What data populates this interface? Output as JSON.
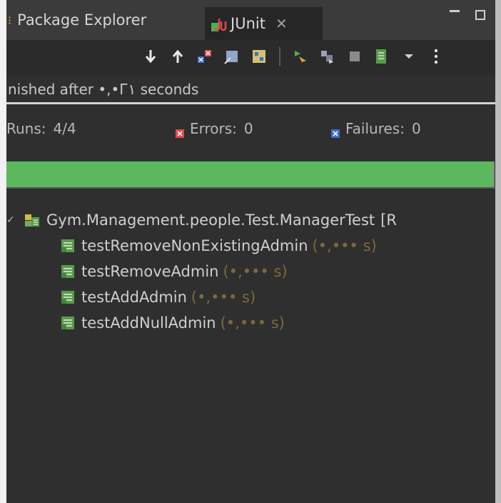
{
  "tabs": {
    "package_explorer": "Package Explorer",
    "junit": "JUnit"
  },
  "status": {
    "text": "nished after •,•Г١ seconds"
  },
  "counters": {
    "runs_label": "Runs:",
    "runs_value": "4/4",
    "errors_label": "Errors:",
    "errors_value": "0",
    "failures_label": "Failures:",
    "failures_value": "0"
  },
  "progress": {
    "fraction": 1.0,
    "color": "#5cb85c"
  },
  "tree": {
    "suite": {
      "name": "Gym.Management.people.Test.ManagerTest",
      "suffix": "[R"
    },
    "tests": [
      {
        "name": "testRemoveNonExistingAdmin",
        "time": "(•,••• s)"
      },
      {
        "name": "testRemoveAdmin",
        "time": "(•,••• s)"
      },
      {
        "name": "testAddAdmin",
        "time": "(•,••• s)"
      },
      {
        "name": "testAddNullAdmin",
        "time": "(•,••• s)"
      }
    ]
  },
  "colors": {
    "background": "#2f2f2f",
    "success": "#5cb85c",
    "error": "#e04a4a",
    "failure": "#3a6fd0"
  },
  "toolbar_icons": [
    "next-failure-icon",
    "previous-failure-icon",
    "show-failures-only-icon",
    "scroll-lock-icon",
    "show-skipped-icon",
    "rerun-test-icon",
    "rerun-failed-first-icon",
    "stop-icon",
    "test-run-history-icon",
    "dropdown-icon",
    "view-menu-icon"
  ]
}
